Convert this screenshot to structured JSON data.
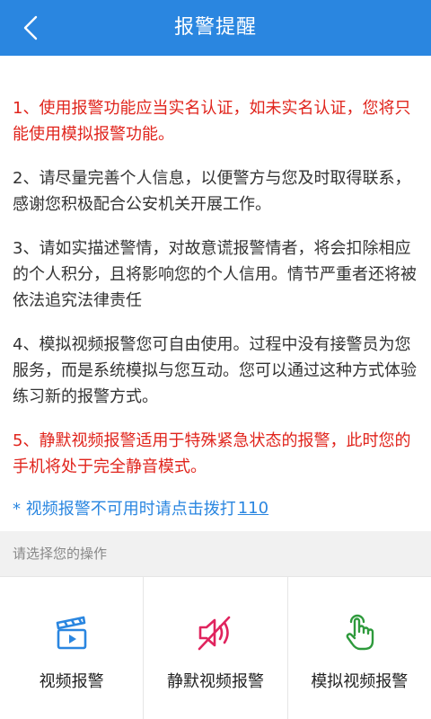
{
  "header": {
    "title": "报警提醒",
    "background": "#2a86e0"
  },
  "notices": [
    {
      "text": "1、使用报警功能应当实名认证，如未实名认证，您将只能使用模拟报警功能。",
      "highlight": true
    },
    {
      "text": "2、请尽量完善个人信息，以便警方与您及时取得联系，感谢您积极配合公安机关开展工作。",
      "highlight": false
    },
    {
      "text": "3、请如实描述警情，对故意谎报警情者，将会扣除相应的个人积分，且将影响您的个人信用。情节严重者还将被依法追究法律责任",
      "highlight": false
    },
    {
      "text": "4、模拟视频报警您可自由使用。过程中没有接警员为您服务，而是系统模拟与您互动。您可以通过这种方式体验练习新的报警方式。",
      "highlight": false
    },
    {
      "text": "5、静默视频报警适用于特殊紧急状态的报警，此时您的手机将处于完全静音模式。",
      "highlight": true
    }
  ],
  "hotline": {
    "prefix": "* 视频报警不可用时请点击拨打",
    "number": "110"
  },
  "section": {
    "title": "请选择您的操作"
  },
  "actions": [
    {
      "label": "视频报警",
      "icon": "video-camera-icon",
      "color": "#2a86e0"
    },
    {
      "label": "静默视频报警",
      "icon": "speaker-mute-icon",
      "color": "#e0245e"
    },
    {
      "label": "模拟视频报警",
      "icon": "hand-tap-icon",
      "color": "#2e9a3c"
    }
  ],
  "colors": {
    "accent": "#2a86e0",
    "warning": "#e0241c",
    "text": "#333333"
  }
}
